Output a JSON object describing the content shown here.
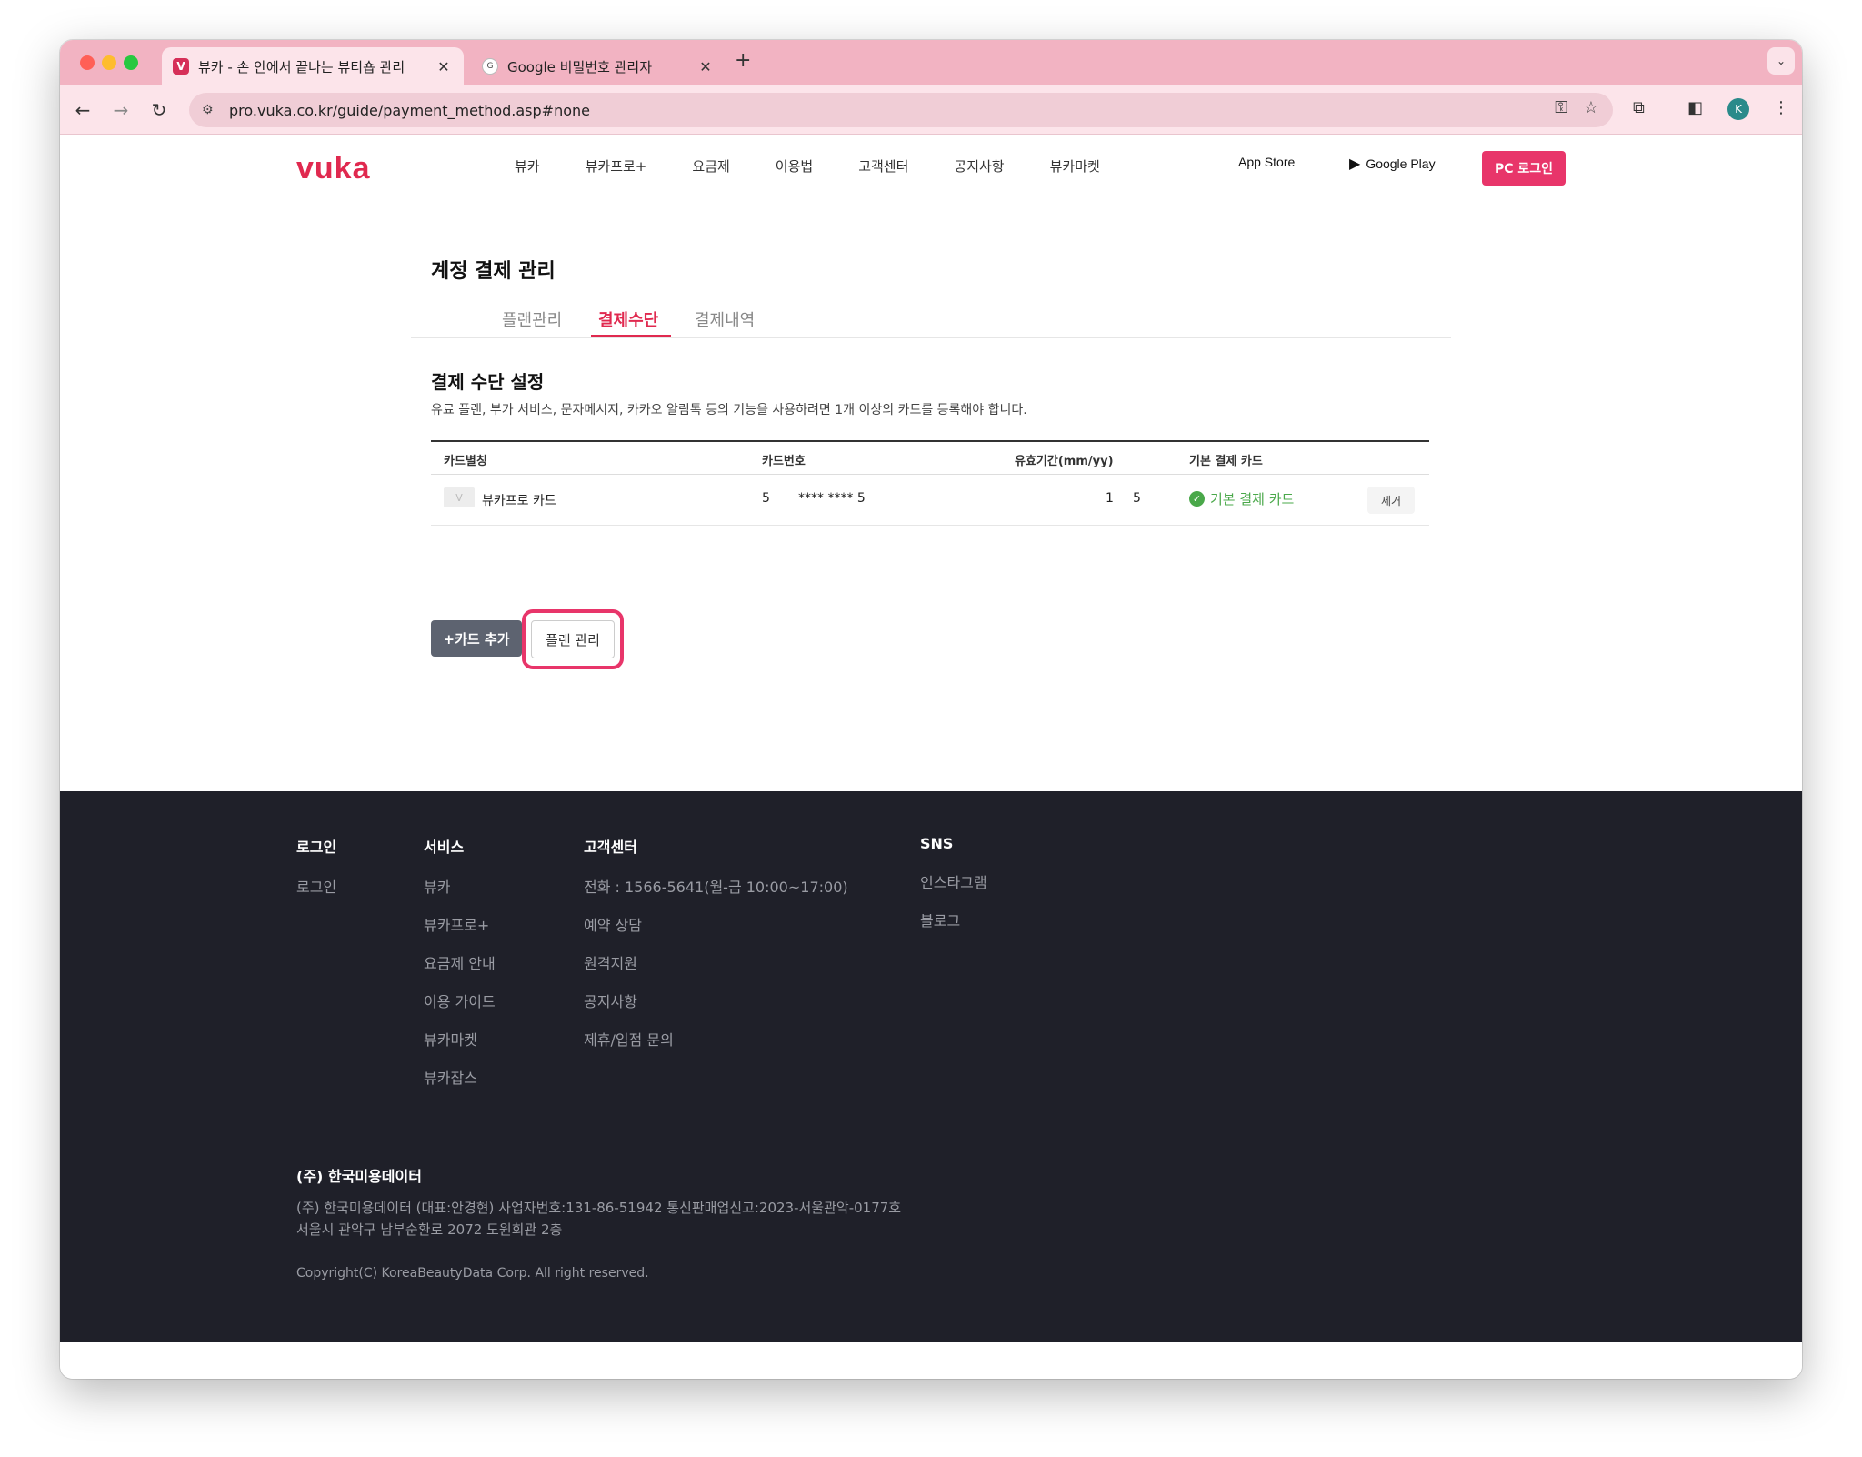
{
  "browser": {
    "tabs": [
      {
        "title": "뷰카 - 손 안에서 끝나는 뷰티숍 관리",
        "favicon": "vuka-icon",
        "active": true
      },
      {
        "title": "Google 비밀번호 관리자",
        "favicon": "google-password-icon",
        "active": false
      }
    ],
    "url": "pro.vuka.co.kr/guide/payment_method.asp#none",
    "avatar_letter": "K"
  },
  "header": {
    "logo": "vuka",
    "nav": [
      "뷰카",
      "뷰카프로+",
      "요금제",
      "이용법",
      "고객센터",
      "공지사항",
      "뷰카마켓"
    ],
    "app_store": "App Store",
    "google_play": "Google Play",
    "pc_login": "PC 로그인"
  },
  "account": {
    "title": "계정 결제 관리",
    "tabs": [
      "플랜관리",
      "결제수단",
      "결제내역"
    ],
    "active_tab": "결제수단"
  },
  "payment_method": {
    "title": "결제 수단 설정",
    "description": "유료 플랜, 부가 서비스, 문자메시지, 카카오 알림톡 등의 기능을 사용하려면 1개 이상의 카드를 등록해야 합니다.",
    "columns": [
      "카드별칭",
      "카드번호",
      "유효기간(mm/yy)",
      "기본 결제 카드"
    ],
    "rows": [
      {
        "alias": "뷰카프로 카드",
        "number_prefix": "5",
        "number_masked": "**** **** 5",
        "expiry_month": "1",
        "expiry_year": "5",
        "default_label": "기본 결제 카드",
        "remove_label": "제거"
      }
    ],
    "add_card_label": "+카드 추가",
    "plan_manage_label": "플랜 관리",
    "highlight_color": "#e8356a"
  },
  "footer": {
    "columns": [
      {
        "heading": "로그인",
        "items": [
          "로그인"
        ]
      },
      {
        "heading": "서비스",
        "items": [
          "뷰카",
          "뷰카프로+",
          "요금제 안내",
          "이용 가이드",
          "뷰카마켓",
          "뷰카잡스"
        ]
      },
      {
        "heading": "고객센터",
        "items": [
          "전화 : 1566-5641(월-금 10:00~17:00)",
          "예약 상담",
          "원격지원",
          "공지사항",
          "제휴/입점 문의"
        ]
      },
      {
        "heading": "SNS",
        "items": [
          "인스타그램",
          "블로그"
        ]
      }
    ],
    "company": "(주) 한국미용데이터",
    "info_line1": "(주) 한국미용데이터 (대표:안경현)  사업자번호:131-86-51942  통신판매업신고:2023-서울관악-0177호",
    "info_line2": "서울시 관악구 남부순환로 2072 도원회관 2층",
    "copyright": "Copyright(C) KoreaBeautyData Corp. All right reserved."
  },
  "colors": {
    "brand": "#e0294f",
    "footer_bg": "#1f2029",
    "default_green": "#4aa84a"
  }
}
